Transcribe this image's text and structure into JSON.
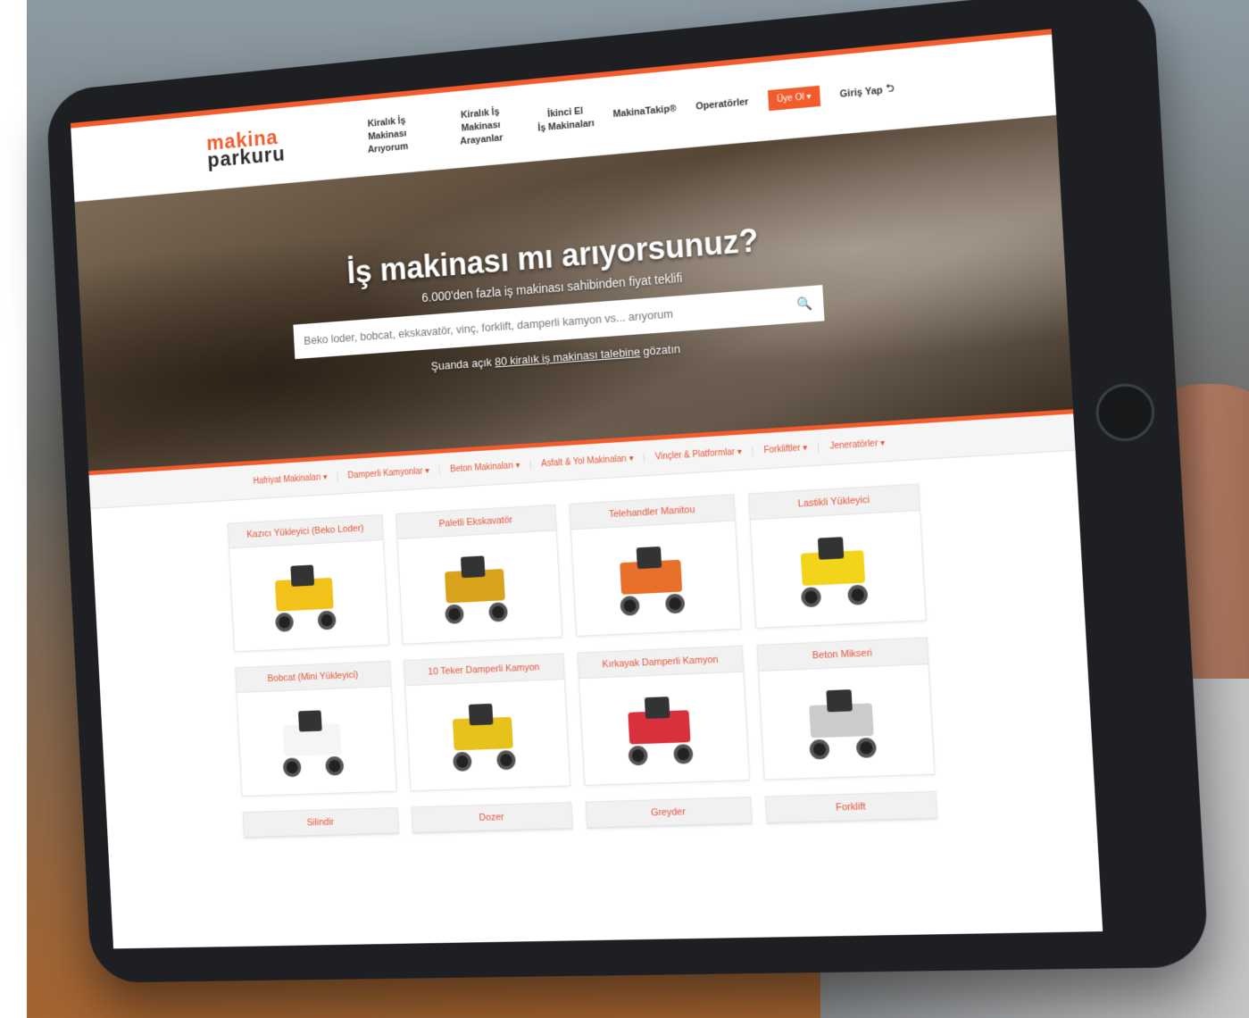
{
  "colors": {
    "brand": "#f25b2b",
    "text": "#333333",
    "category": "#e4563a"
  },
  "logo": {
    "line1": "makina",
    "line2": "parkuru"
  },
  "nav": {
    "items": [
      {
        "line1": "Kiralık İş Makinası",
        "line2": "Arıyorum"
      },
      {
        "line1": "Kiralık İş Makinası",
        "line2": "Arayanlar"
      },
      {
        "line1": "İkinci El",
        "line2": "İş Makinaları"
      },
      {
        "line1": "MakinaTakip®",
        "line2": ""
      },
      {
        "line1": "Operatörler",
        "line2": ""
      }
    ],
    "member_button": "Üye Ol",
    "login": "Giriş Yap"
  },
  "hero": {
    "title": "İş makinası mı arıyorsunuz?",
    "subtitle": "6.000'den fazla iş makinası sahibinden fiyat teklifi",
    "search_placeholder": "Beko loder, bobcat, ekskavatör, vinç, forklift, damperli kamyon vs... arıyorum",
    "note_prefix": "Şuanda açık",
    "note_link": "80 kiralık iş makinası talebine",
    "note_suffix": "gözatın"
  },
  "categories": [
    "Hafriyat Makinaları",
    "Damperli Kamyonlar",
    "Beton Makinaları",
    "Asfalt & Yol Makinaları",
    "Vinçler & Platformlar",
    "Forkliftler",
    "Jeneratörler"
  ],
  "products": [
    {
      "title": "Kazıcı Yükleyici (Beko Loder)",
      "color": "#f2c21b"
    },
    {
      "title": "Paletli Ekskavatör",
      "color": "#d9a21b"
    },
    {
      "title": "Telehandler Manitou",
      "color": "#e8702a"
    },
    {
      "title": "Lastikli Yükleyici",
      "color": "#f2d41b"
    },
    {
      "title": "Bobcat (Mini Yükleyici)",
      "color": "#f5f5f5"
    },
    {
      "title": "10 Teker Damperli Kamyon",
      "color": "#e6c21b"
    },
    {
      "title": "Kırkayak Damperli Kamyon",
      "color": "#d8313c"
    },
    {
      "title": "Beton Mikseri",
      "color": "#c9cbcd"
    },
    {
      "title": "Silindir",
      "color": ""
    },
    {
      "title": "Dozer",
      "color": ""
    },
    {
      "title": "Greyder",
      "color": ""
    },
    {
      "title": "Forklift",
      "color": ""
    }
  ]
}
